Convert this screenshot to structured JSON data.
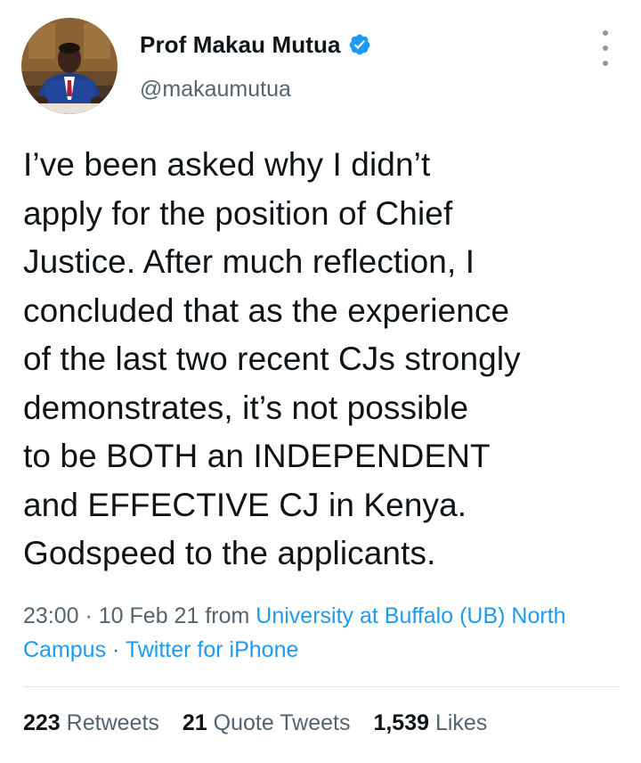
{
  "author": {
    "display_name": "Prof Makau Mutua",
    "handle": "@makaumutua",
    "verified_icon": "verified-badge-icon",
    "avatar_icon": "profile-photo"
  },
  "tweet": {
    "text": "I’ve been asked why I didn’t\napply for the position of Chief\nJustice.  After much reflection, I\nconcluded that as the experience\nof the last two recent CJs strongly\ndemonstrates, it’s not possible\nto be BOTH an INDEPENDENT\nand EFFECTIVE CJ in Kenya.\nGodspeed to the applicants."
  },
  "meta": {
    "time": "23:00",
    "separator": " · ",
    "date": "10 Feb 21",
    "from_label": " from ",
    "location": "University at Buffalo (UB) North Campus",
    "separator2": " · ",
    "source": "Twitter for iPhone"
  },
  "stats": {
    "retweets_count": "223",
    "retweets_label": "Retweets",
    "quotes_count": "21",
    "quotes_label": "Quote Tweets",
    "likes_count": "1,539",
    "likes_label": "Likes"
  },
  "colors": {
    "text": "#0f1419",
    "secondary": "#536471",
    "link": "#1d9bf0",
    "verified": "#1d9bf0"
  }
}
